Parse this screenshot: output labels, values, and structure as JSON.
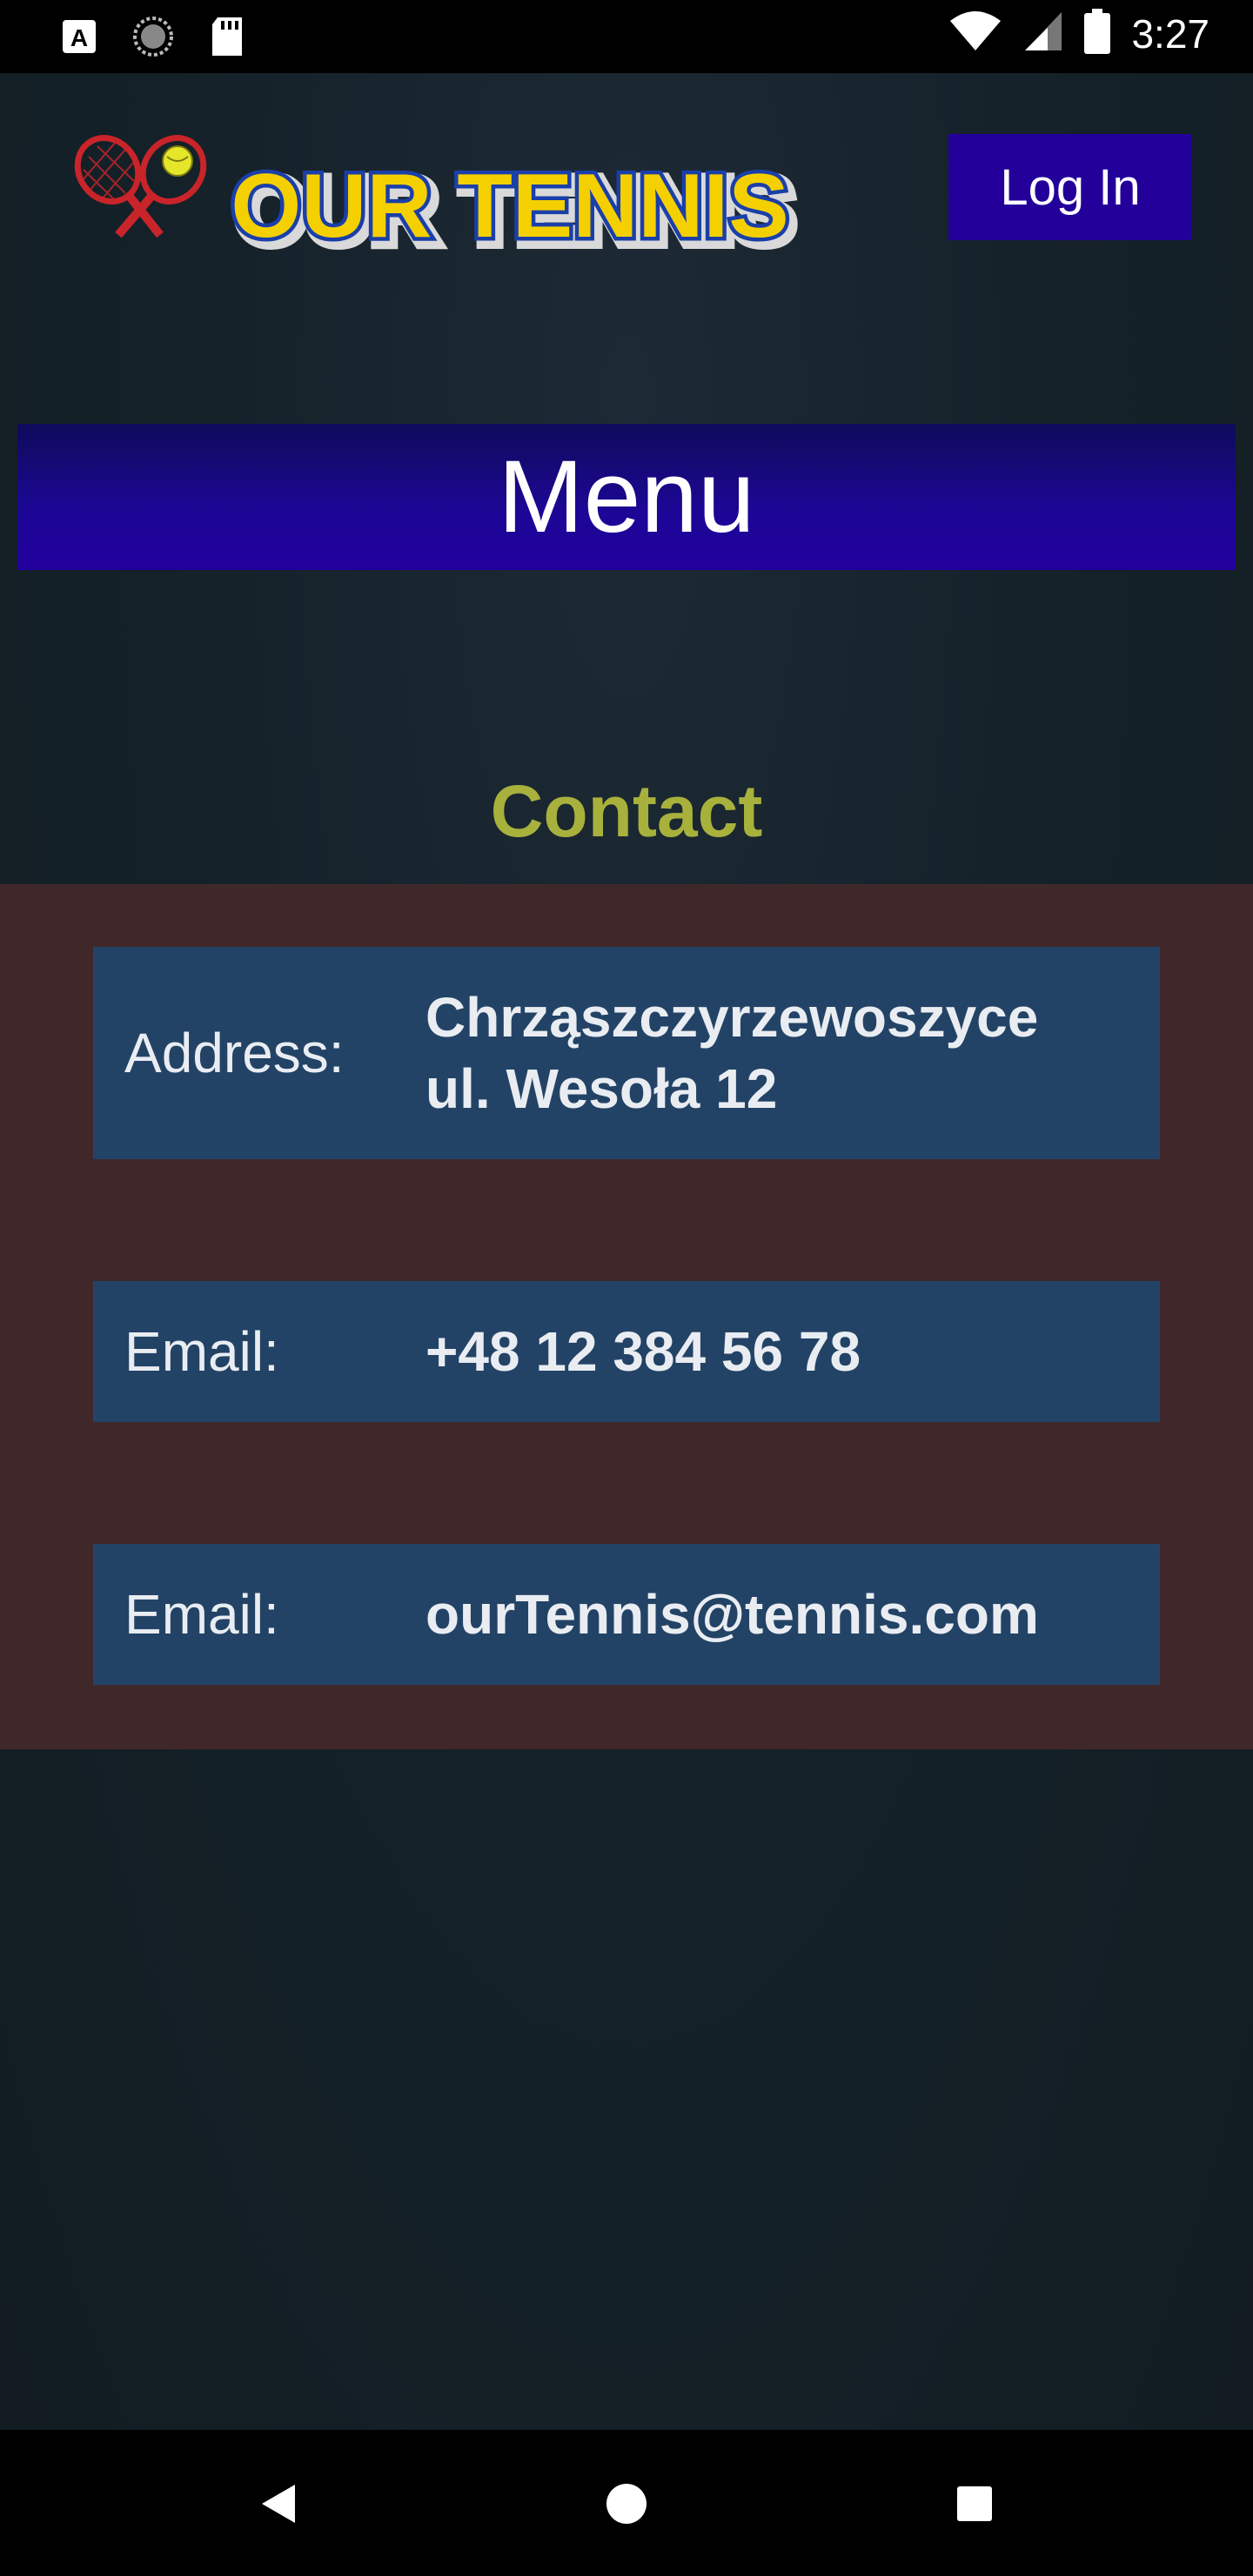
{
  "status_bar": {
    "time": "3:27",
    "icons_left": [
      "font-a-icon",
      "sync-icon",
      "sd-card-icon"
    ],
    "icons_right": [
      "wifi-icon",
      "signal-icon",
      "battery-icon"
    ]
  },
  "header": {
    "logo_text": "OUR TENNIS",
    "login_label": "Log In"
  },
  "menu": {
    "label": "Menu"
  },
  "section": {
    "title": "Contact"
  },
  "contact": {
    "address_label": "Address:",
    "address_line1": "Chrząszczyrzewoszyce",
    "address_line2": "ul. Wesoła 12",
    "phone_label": "Email:",
    "phone_value": "+48 12 384 56 78",
    "email_label": "Email:",
    "email_value": "ourTennis@tennis.com"
  },
  "colors": {
    "accent": "#24009a",
    "title": "#a8b13c",
    "panel": "#40282a",
    "row": "#234366",
    "logo_yellow": "#f5d000",
    "logo_blue": "#1b3fa8",
    "racket_red": "#c8242a"
  }
}
